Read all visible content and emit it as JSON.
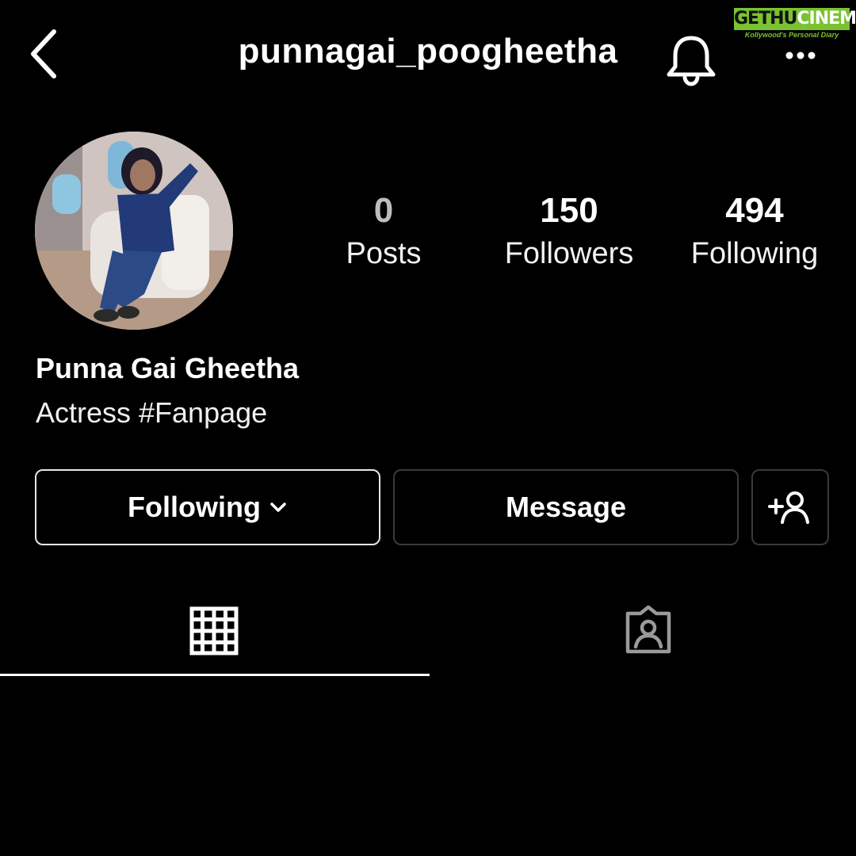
{
  "header": {
    "username": "punnagai_poogheetha",
    "back_icon": "chevron-left-icon",
    "bell_icon": "bell-icon",
    "more_icon": "more-horizontal-icon"
  },
  "watermark": {
    "brand_a": "GETHU",
    "brand_b": "CINEMA",
    "tagline": "Kollywood's Personal Diary",
    "color": "#7ac231"
  },
  "profile": {
    "avatar_icon": "profile-photo",
    "stats": [
      {
        "value": "0",
        "label": "Posts"
      },
      {
        "value": "150",
        "label": "Followers"
      },
      {
        "value": "494",
        "label": "Following"
      }
    ],
    "display_name": "Punna Gai Gheetha",
    "bio": "Actress #Fanpage"
  },
  "actions": {
    "following_label": "Following",
    "message_label": "Message",
    "add_person_icon": "add-person-icon"
  },
  "tabs": {
    "active": "grid",
    "items": [
      {
        "name": "grid",
        "icon": "grid-icon"
      },
      {
        "name": "tagged",
        "icon": "tagged-person-icon"
      }
    ]
  }
}
